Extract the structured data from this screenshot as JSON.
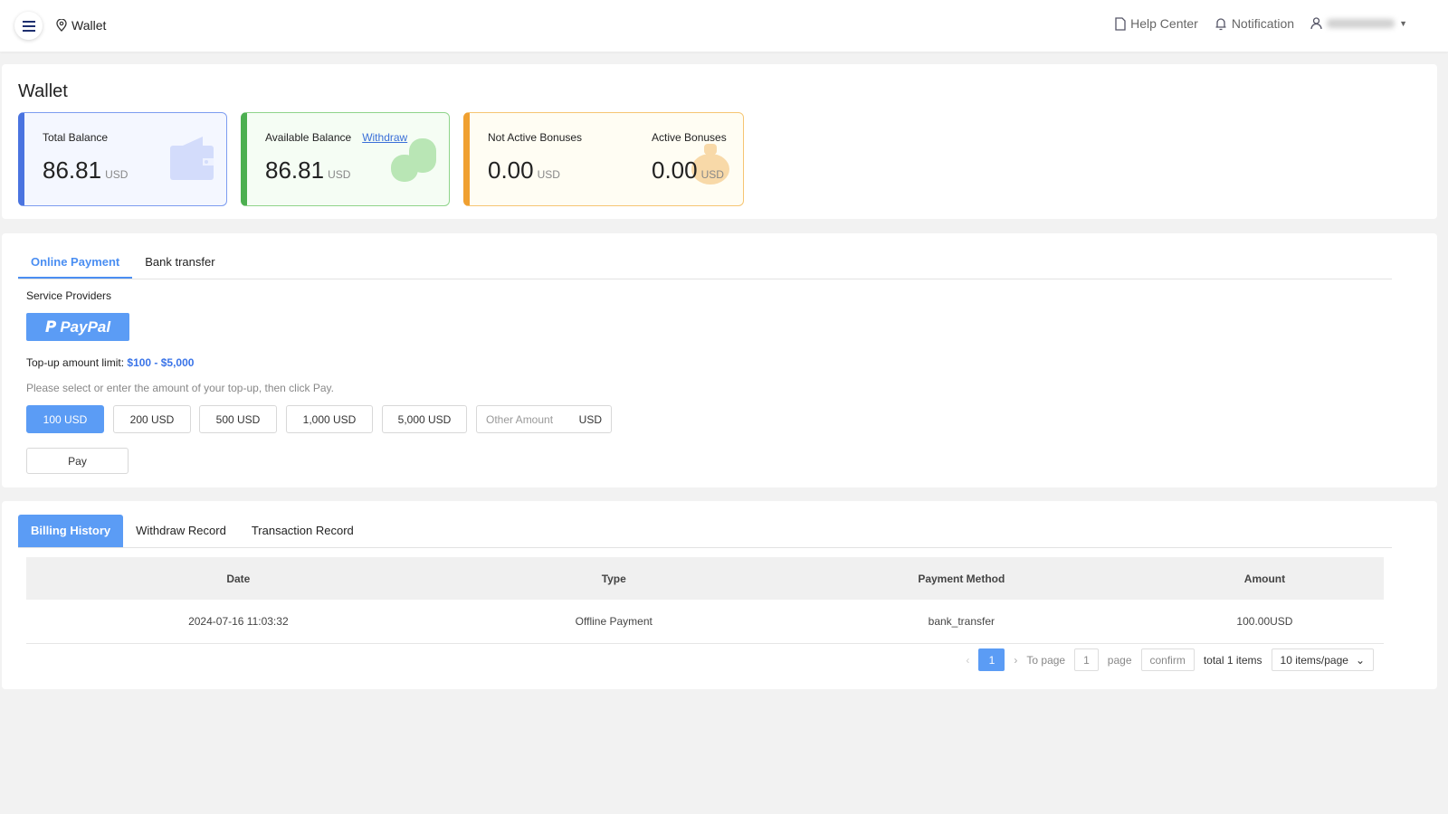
{
  "header": {
    "breadcrumb": "Wallet",
    "help_center": "Help Center",
    "notification": "Notification"
  },
  "wallet": {
    "title": "Wallet",
    "total_balance": {
      "label": "Total Balance",
      "value": "86.81",
      "currency": "USD"
    },
    "available_balance": {
      "label": "Available Balance",
      "withdraw": "Withdraw",
      "value": "86.81",
      "currency": "USD"
    },
    "not_active_bonuses": {
      "label": "Not Active Bonuses",
      "value": "0.00",
      "currency": "USD"
    },
    "active_bonuses": {
      "label": "Active Bonuses",
      "value": "0.00",
      "currency": "USD"
    }
  },
  "topup": {
    "tabs": [
      "Online Payment",
      "Bank transfer"
    ],
    "providers_label": "Service Providers",
    "provider": "PayPal",
    "limit_label": "Top-up amount limit:",
    "limit_value": "$100 - $5,000",
    "hint": "Please select or enter the amount of your top-up, then click Pay.",
    "amounts": [
      "100 USD",
      "200 USD",
      "500 USD",
      "1,000 USD",
      "5,000 USD"
    ],
    "other_placeholder": "Other Amount",
    "other_currency": "USD",
    "pay": "Pay"
  },
  "history": {
    "tabs": [
      "Billing History",
      "Withdraw Record",
      "Transaction Record"
    ],
    "columns": [
      "Date",
      "Type",
      "Payment Method",
      "Amount"
    ],
    "rows": [
      [
        "2024-07-16 11:03:32",
        "Offline Payment",
        "bank_transfer",
        "100.00USD"
      ]
    ],
    "pager": {
      "current": "1",
      "to_page": "To page",
      "page_input": "1",
      "page": "page",
      "confirm": "confirm",
      "total": "total 1 items",
      "per_page": "10 items/page"
    }
  }
}
